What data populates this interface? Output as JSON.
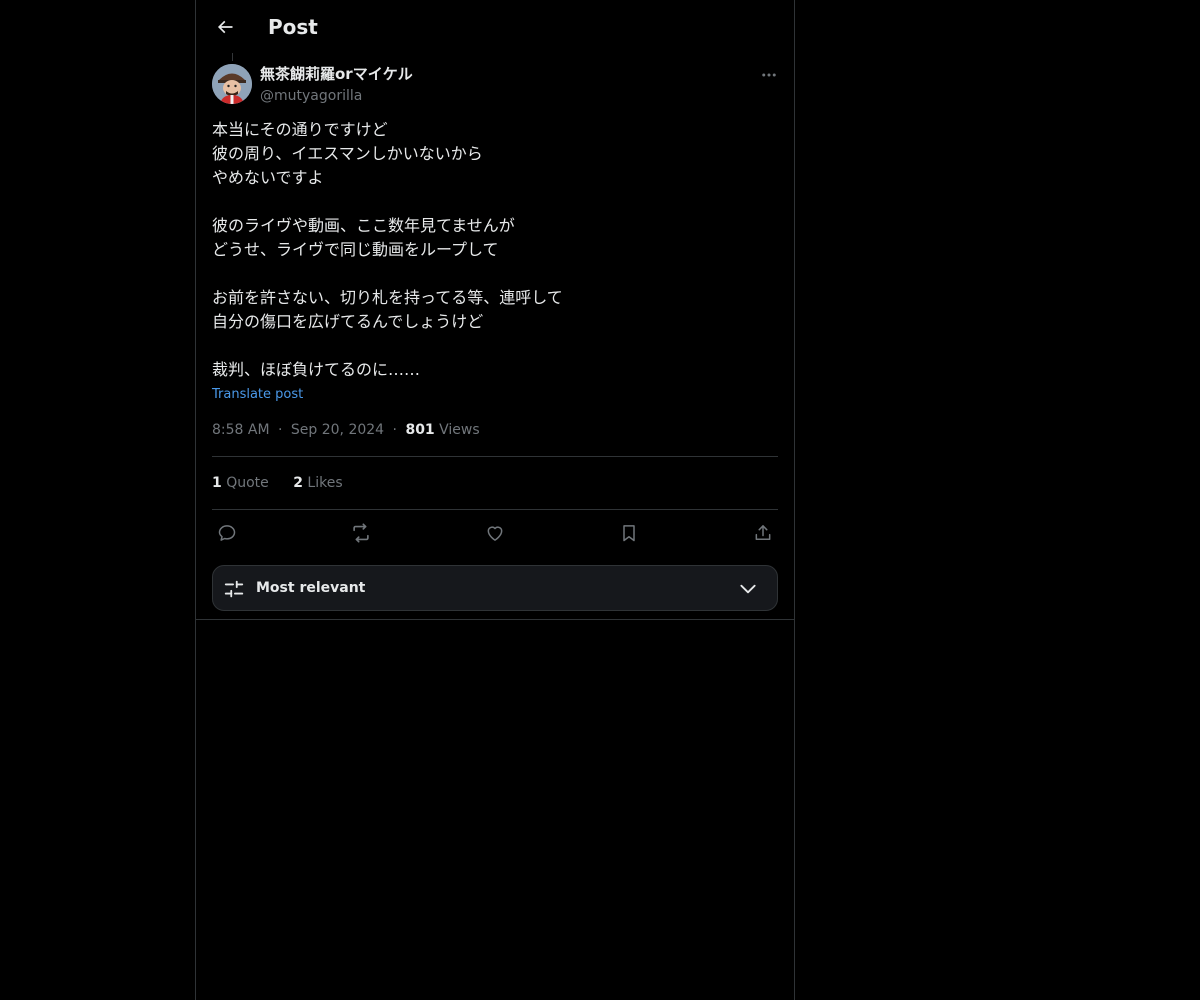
{
  "header": {
    "title": "Post"
  },
  "author": {
    "display_name": "無茶餬莉羅orマイケル",
    "handle": "@mutyagorilla"
  },
  "post": {
    "lines": [
      "本当にその通りですけど",
      "彼の周り、イエスマンしかいないから",
      "やめないですよ",
      "",
      "彼のライヴや動画、ここ数年見てませんが",
      "どうせ、ライヴで同じ動画をループして",
      "",
      "お前を許さない、切り札を持ってる等、連呼して",
      "自分の傷口を広げてるんでしょうけど",
      "",
      "裁判、ほぼ負けてるのに……"
    ],
    "translate_label": "Translate post",
    "time": "8:58 AM",
    "date": "Sep 20, 2024",
    "separator": "·",
    "views_count": "801",
    "views_label": "Views"
  },
  "stats": {
    "quotes_count": "1",
    "quotes_label": "Quote",
    "likes_count": "2",
    "likes_label": "Likes"
  },
  "icons": {
    "back": "arrow-left-icon",
    "more": "more-horizontal-icon",
    "reply": "reply-icon",
    "repost": "repost-icon",
    "like": "heart-icon",
    "bookmark": "bookmark-icon",
    "share": "share-icon",
    "sort": "sliders-icon",
    "dropdown": "chevron-down-icon"
  },
  "sort": {
    "label": "Most relevant"
  },
  "colors": {
    "background": "#000000",
    "text": "#e7e9ea",
    "muted": "#71767b",
    "link": "#4a99e9",
    "border": "#2f3336"
  }
}
